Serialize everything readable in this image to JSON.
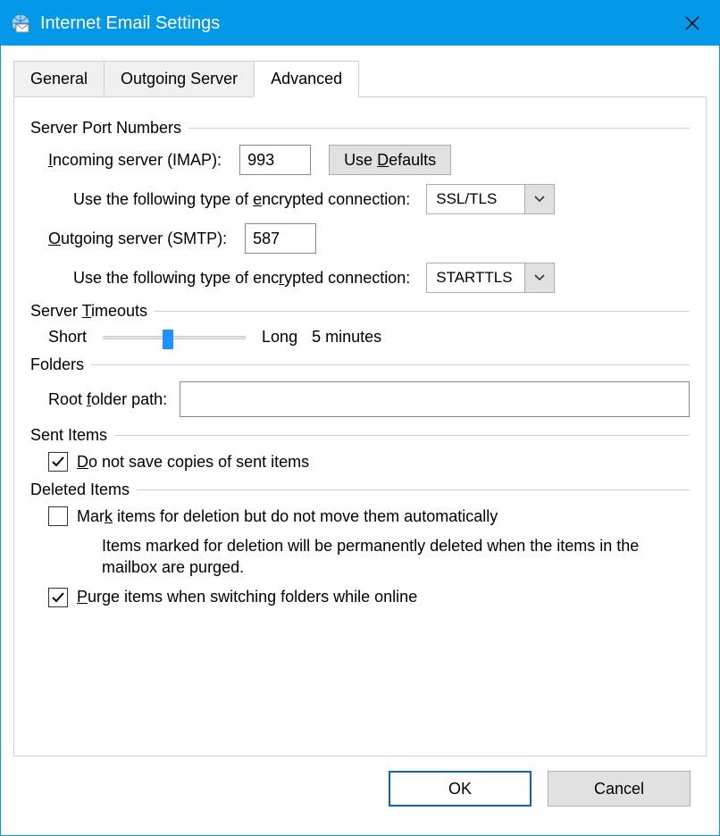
{
  "window": {
    "title": "Internet Email Settings"
  },
  "tabs": {
    "general": "General",
    "outgoing": "Outgoing Server",
    "advanced": "Advanced"
  },
  "groups": {
    "ports": "Server Port Numbers",
    "timeouts_pre": "Server ",
    "timeouts_u": "T",
    "timeouts_post": "imeouts",
    "folders": "Folders",
    "sent": "Sent Items",
    "deleted": "Deleted Items"
  },
  "incoming": {
    "label_u": "I",
    "label_post": "ncoming server (IMAP):",
    "value": "993",
    "defaults_pre": "Use ",
    "defaults_u": "D",
    "defaults_post": "efaults",
    "enc_pre": "Use the following type of ",
    "enc_u": "e",
    "enc_post": "ncrypted connection:",
    "enc_value": "SSL/TLS"
  },
  "outgoing": {
    "label_u": "O",
    "label_post": "utgoing server (SMTP):",
    "value": "587",
    "enc_pre": "Use the following type of enc",
    "enc_u": "r",
    "enc_post": "ypted connection:",
    "enc_value": "STARTTLS"
  },
  "timeouts": {
    "short": "Short",
    "long": "Long",
    "value": "5 minutes"
  },
  "folders_row": {
    "label_pre": "Root ",
    "label_u": "f",
    "label_post": "older path:",
    "value": ""
  },
  "sent_items": {
    "chk_u": "D",
    "chk_post": "o not save copies of sent items",
    "checked": true
  },
  "deleted_items": {
    "mark_pre": "Mar",
    "mark_u": "k",
    "mark_post": " items for deletion but do not move them automatically",
    "mark_checked": false,
    "help": "Items marked for deletion will be permanently deleted when the items in the mailbox are purged.",
    "purge_u": "P",
    "purge_post": "urge items when switching folders while online",
    "purge_checked": true
  },
  "buttons": {
    "ok": "OK",
    "cancel": "Cancel"
  }
}
